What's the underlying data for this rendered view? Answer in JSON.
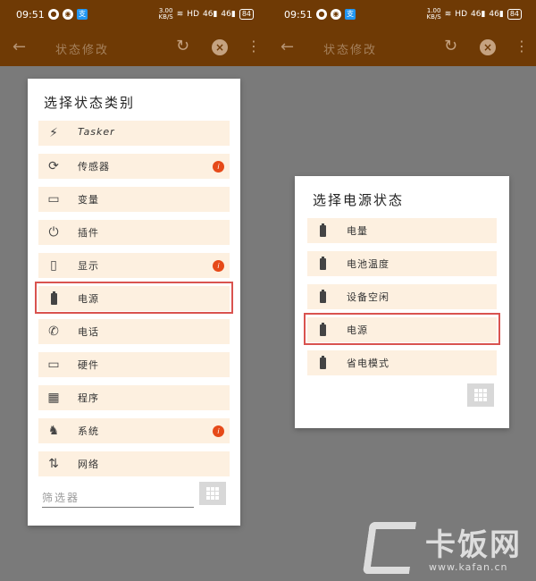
{
  "left_phone": {
    "status": {
      "time": "09:51",
      "net_speed": "3.00",
      "net_unit": "KB/S",
      "hd": "HD",
      "signal1": "46",
      "signal2": "46",
      "battery": "84"
    },
    "toolbar": {
      "title": "状态修改"
    },
    "dialog": {
      "title": "选择状态类别",
      "items": [
        {
          "label": "Tasker",
          "icon": "⚡",
          "badge": ""
        },
        {
          "label": "传感器",
          "icon": "⟳",
          "badge": "i"
        },
        {
          "label": "变量",
          "icon": "▭",
          "badge": ""
        },
        {
          "label": "插件",
          "icon": "⏻",
          "badge": ""
        },
        {
          "label": "显示",
          "icon": "▯",
          "badge": "i"
        },
        {
          "label": "电源",
          "icon": "battery",
          "badge": ""
        },
        {
          "label": "电话",
          "icon": "✆",
          "badge": ""
        },
        {
          "label": "硬件",
          "icon": "💻",
          "badge": ""
        },
        {
          "label": "程序",
          "icon": "▦",
          "badge": ""
        },
        {
          "label": "系统",
          "icon": "🤖",
          "badge": "i"
        },
        {
          "label": "网络",
          "icon": "⇅",
          "badge": ""
        }
      ],
      "filter_placeholder": "筛选器"
    }
  },
  "right_phone": {
    "status": {
      "time": "09:51",
      "net_speed": "1.00",
      "net_unit": "KB/S",
      "hd": "HD",
      "signal1": "46",
      "signal2": "46",
      "battery": "84"
    },
    "toolbar": {
      "title": "状态修改"
    },
    "dialog": {
      "title": "选择电源状态",
      "items": [
        {
          "label": "电量"
        },
        {
          "label": "电池温度"
        },
        {
          "label": "设备空闲"
        },
        {
          "label": "电源"
        },
        {
          "label": "省电模式"
        }
      ]
    }
  },
  "watermark": {
    "brand": "卡饭网",
    "url": "www.kafan.cn"
  }
}
